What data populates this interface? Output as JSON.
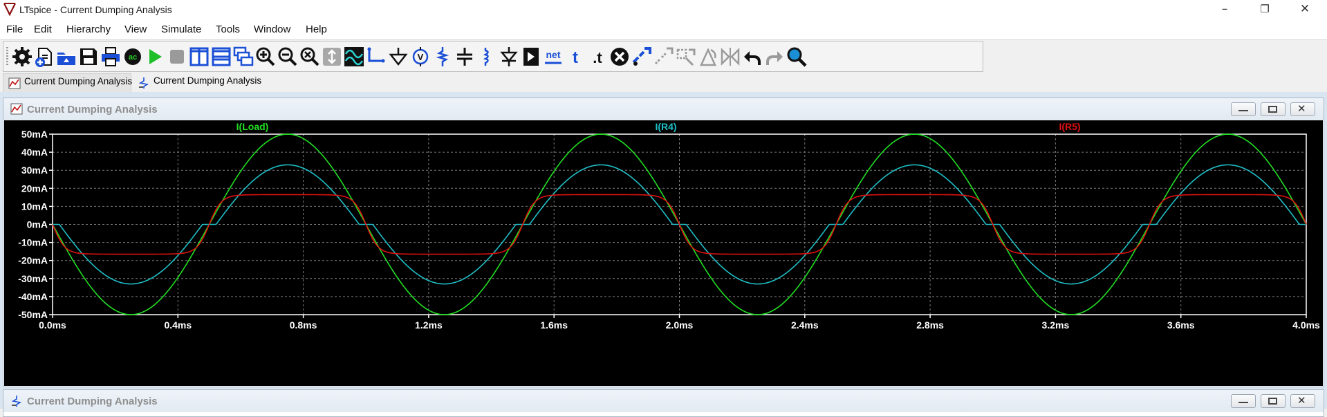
{
  "window": {
    "title": "LTspice - Current Dumping Analysis",
    "minimize_glyph": "–",
    "maximize_glyph": "❐",
    "close_glyph": "✕"
  },
  "menu": [
    "File",
    "Edit",
    "Hierarchy",
    "View",
    "Simulate",
    "Tools",
    "Window",
    "Help"
  ],
  "toolbar": {
    "icons": [
      "gear-icon",
      "new-schematic-icon",
      "open-icon",
      "save-icon",
      "print-icon",
      "control-panel-icon",
      "run-icon",
      "halt-icon",
      "tile-vertical-icon",
      "tile-horizontal-icon",
      "cascade-icon",
      "zoom-in-icon",
      "zoom-out-icon",
      "zoom-fit-icon",
      "autorange-icon",
      "add-trace-icon",
      "draw-wire-icon",
      "ground-icon",
      "voltage-source-icon",
      "resistor-icon",
      "capacitor-icon",
      "inductor-icon",
      "diode-icon",
      "component-icon",
      "label-net-icon",
      "text-icon",
      "spice-directive-icon",
      "delete-icon",
      "duplicate-icon",
      "move-icon",
      "drag-icon",
      "rotate-icon",
      "mirror-icon",
      "undo-icon",
      "redo-icon",
      "find-icon"
    ],
    "net_label": "net",
    "text_label": "t",
    "directive_label": ".t"
  },
  "tabs": [
    {
      "label": "Current Dumping Analysis",
      "kind": "waveform"
    },
    {
      "label": "Current Dumping Analysis",
      "kind": "schematic"
    }
  ],
  "plot_window": {
    "title": "Current Dumping Analysis",
    "background": "#000000",
    "axis_color": "#ffffff",
    "grid_color": "#7a7a7a"
  },
  "schematic_window": {
    "title": "Current Dumping Analysis"
  },
  "chart_data": {
    "type": "line",
    "title": "",
    "xlabel": "",
    "ylabel": "",
    "xlim": [
      0,
      4.0
    ],
    "ylim": [
      -50,
      50
    ],
    "grid": true,
    "x_ticks": [
      "0.0ms",
      "0.4ms",
      "0.8ms",
      "1.2ms",
      "1.6ms",
      "2.0ms",
      "2.4ms",
      "2.8ms",
      "3.2ms",
      "3.6ms",
      "4.0ms"
    ],
    "y_ticks": [
      "50mA",
      "40mA",
      "30mA",
      "20mA",
      "10mA",
      "0mA",
      "-10mA",
      "-20mA",
      "-30mA",
      "-40mA",
      "-50mA"
    ],
    "x_unit": "ms",
    "y_unit": "mA",
    "period_ms": 1.0,
    "series": [
      {
        "name": "I(Load)",
        "color": "#22e022",
        "amplitude_mA": 50,
        "shape": "-sin",
        "legend_pos": "left"
      },
      {
        "name": "I(R4)",
        "color": "#1fc0c8",
        "amplitude_mA": 33,
        "deadband_mA": 4.5,
        "shape": "-sin deadband",
        "legend_pos": "center"
      },
      {
        "name": "I(R5)",
        "color": "#e01010",
        "amplitude_mA": 16.5,
        "shape": "-sin clipped",
        "legend_pos": "right"
      }
    ]
  }
}
